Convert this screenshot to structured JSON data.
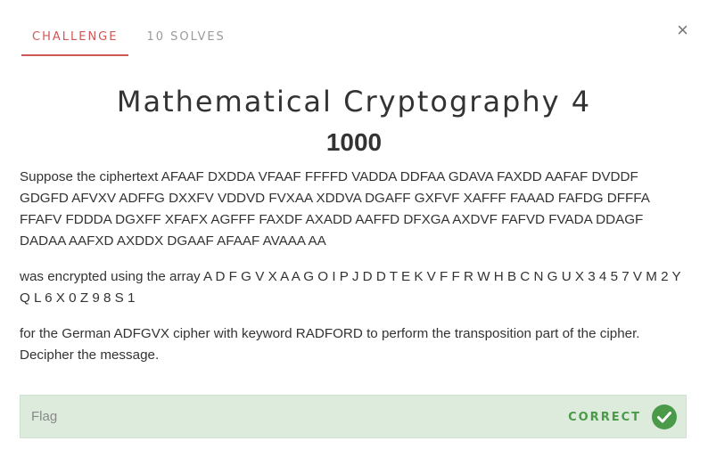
{
  "tabs": [
    {
      "label": "CHALLENGE"
    },
    {
      "label": "10 SOLVES"
    }
  ],
  "close_label": "×",
  "challenge": {
    "title": "Mathematical Cryptography 4",
    "value": "1000",
    "description": [
      "Suppose the ciphertext AFAAF DXDDA VFAAF FFFFD VADDA DDFAA GDAVA FAXDD AAFAF DVDDF GDGFD AFVXV ADFFG DXXFV VDDVD FVXAA XDDVA DGAFF GXFVF XAFFF FAAAD FAFDG DFFFA FFAFV FDDDA DGXFF XFAFX AGFFF FAXDF AXADD AAFFD DFXGA AXDVF FAFVD FVADA DDAGF DADAA AAFXD AXDDX DGAAF AFAAF AVAAA AA",
      "was encrypted using the array A D F G V X A A G O I P J D D T E K V F F R W H B C N G U X 3 4 5 7 V M 2 Y Q L 6 X 0 Z 9 8 S 1",
      "for the German ADFGVX cipher with keyword RADFORD to perform the transposition part of the cipher. Decipher the message."
    ]
  },
  "flag": {
    "placeholder": "Flag",
    "value": "",
    "status": "CORRECT",
    "status_icon": "check-circle-icon",
    "status_color": "#4a9a4a"
  },
  "colors": {
    "accent": "#ce5858",
    "success_bg": "#dcebdc"
  }
}
